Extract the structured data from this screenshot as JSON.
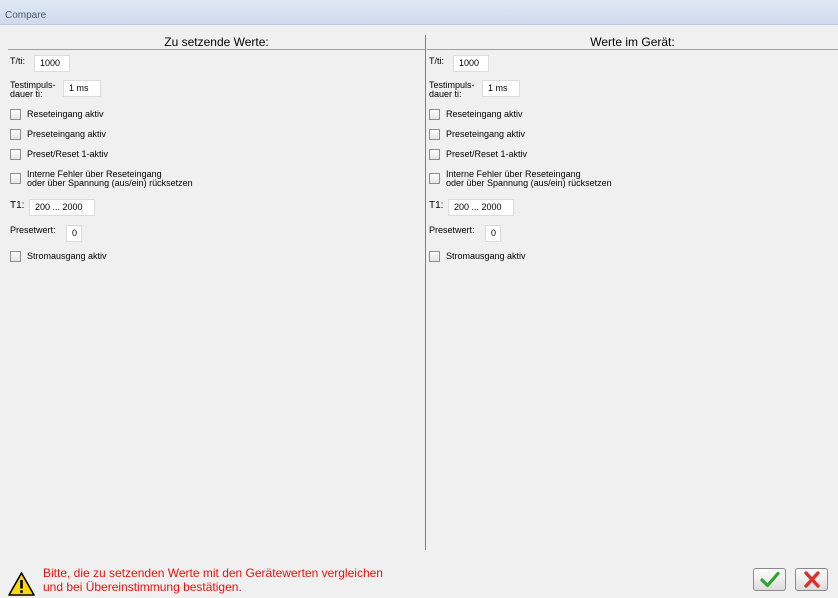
{
  "window": {
    "title": "Compare"
  },
  "left": {
    "heading": "Zu setzende Werte:",
    "tti_label": "T/ti:",
    "tti_value": "1000",
    "testimpuls_label_1": "Testimpuls-",
    "testimpuls_label_2": "dauer ti:",
    "testimpuls_value": "1 ms",
    "reset_label": "Reseteingang aktiv",
    "preset_label": "Preseteingang aktiv",
    "preset_reset_label": "Preset/Reset 1-aktiv",
    "interne_label_1": "Interne Fehler über Reseteingang",
    "interne_label_2": "oder über Spannung (aus/ein) rücksetzen",
    "t1_label": "T1:",
    "t1_value": "200 ... 2000",
    "presetwert_label": "Presetwert:",
    "presetwert_value": "0",
    "strom_label": "Stromausgang aktiv"
  },
  "right": {
    "heading": "Werte im Gerät:",
    "tti_label": "T/ti:",
    "tti_value": "1000",
    "testimpuls_label_1": "Testimpuls-",
    "testimpuls_label_2": "dauer ti:",
    "testimpuls_value": "1 ms",
    "reset_label": "Reseteingang aktiv",
    "preset_label": "Preseteingang aktiv",
    "preset_reset_label": "Preset/Reset 1-aktiv",
    "interne_label_1": "Interne Fehler über Reseteingang",
    "interne_label_2": "oder über Spannung (aus/ein) rücksetzen",
    "t1_label": "T1:",
    "t1_value": "200 ... 2000",
    "presetwert_label": "Presetwert:",
    "presetwert_value": "0",
    "strom_label": "Stromausgang aktiv"
  },
  "footer": {
    "message_line1": "Bitte, die zu setzenden Werte mit den Gerätewerten vergleichen",
    "message_line2": "und bei Übereinstimmung bestätigen.",
    "icons": {
      "warning": "warning-icon",
      "ok": "checkmark-icon",
      "cancel": "close-icon"
    },
    "colors": {
      "message": "#e3140f",
      "ok": "#2fa52a",
      "cancel": "#d9302c"
    }
  }
}
